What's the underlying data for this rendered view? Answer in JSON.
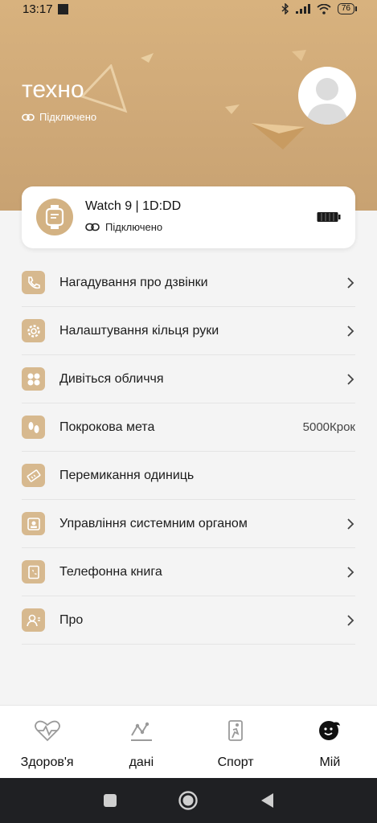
{
  "status_bar": {
    "time": "13:17",
    "battery": "76"
  },
  "header": {
    "title": "техно",
    "connection_status": "Підключено"
  },
  "device": {
    "name": "Watch 9 | 1D:DD",
    "connection_status": "Підключено"
  },
  "menu": {
    "items": [
      {
        "label": "Нагадування про дзвінки",
        "value": "",
        "icon": "phone-icon"
      },
      {
        "label": "Налаштування кільця руки",
        "value": "",
        "icon": "gear-icon"
      },
      {
        "label": "Дивіться обличчя",
        "value": "",
        "icon": "watchface-icon"
      },
      {
        "label": "Покрокова мета",
        "value": "5000Крок",
        "icon": "footsteps-icon"
      },
      {
        "label": "Перемикання одиниць",
        "value": "",
        "icon": "ruler-icon"
      },
      {
        "label": "Управління системним органом",
        "value": "",
        "icon": "system-icon"
      },
      {
        "label": "Телефонна книга",
        "value": "",
        "icon": "phonebook-icon"
      },
      {
        "label": "Про",
        "value": "",
        "icon": "about-icon"
      }
    ]
  },
  "tabs": [
    {
      "label": "Здоров'я",
      "icon": "heart-pulse-icon"
    },
    {
      "label": "дані",
      "icon": "chart-icon"
    },
    {
      "label": "Спорт",
      "icon": "running-icon"
    },
    {
      "label": "Мій",
      "icon": "profile-face-icon"
    }
  ],
  "colors": {
    "accent": "#d7b98f",
    "header_bg": "#d4ae7b"
  }
}
